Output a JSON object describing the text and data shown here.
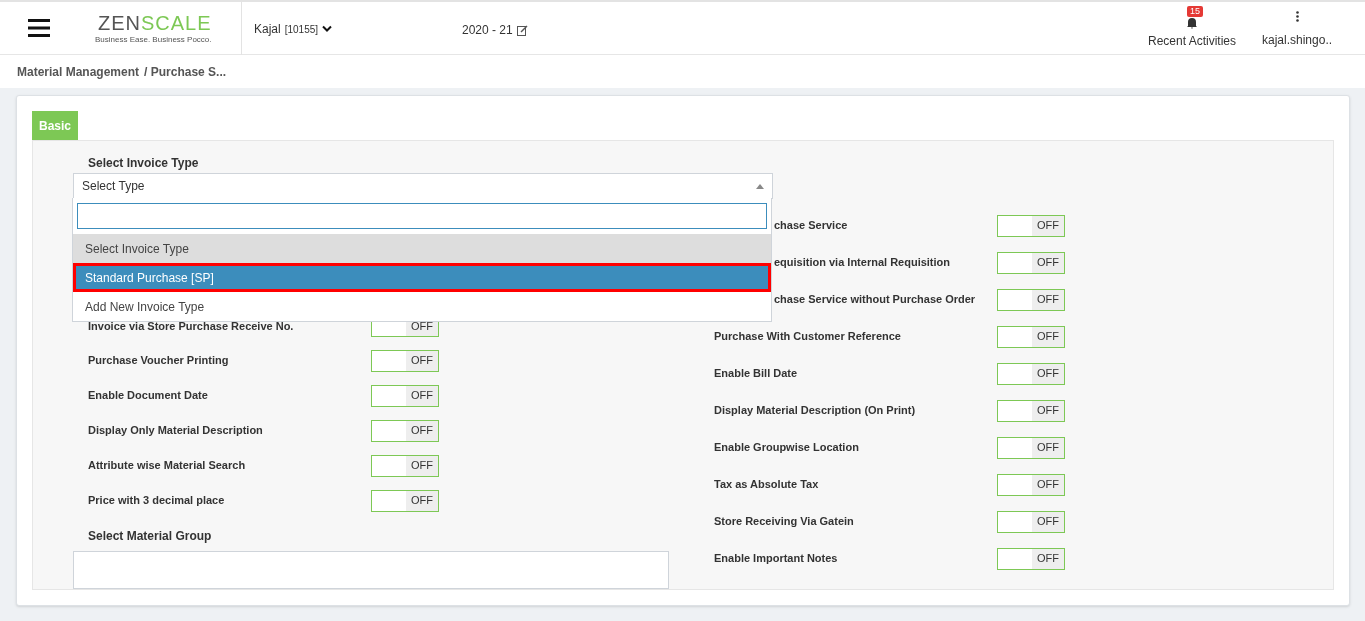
{
  "header": {
    "logo": {
      "dark": "ZEN",
      "light": "SCALE",
      "tagline": "Business Ease. Business Pocco."
    },
    "company": {
      "name": "Kajal",
      "code": "[10155]"
    },
    "year": "2020 - 21",
    "notifications": {
      "count": "15",
      "label": "Recent Activities"
    },
    "user": "kajal.shingo.."
  },
  "breadcrumb": [
    "Material Management",
    "/ Purchase S..."
  ],
  "tabs": [
    {
      "label": "Basic",
      "selected": true
    }
  ],
  "invoice_type": {
    "label": "Select Invoice Type",
    "value": "Select Type",
    "options": [
      {
        "label": "Select Invoice Type",
        "kind": "header",
        "selected": false
      },
      {
        "label": "Standard Purchase [SP]",
        "kind": "option",
        "selected": true
      },
      {
        "label": "Add New Invoice Type",
        "kind": "option",
        "selected": false
      }
    ]
  },
  "left_settings": [
    {
      "label": "Invoice via Store Purchase Receive No.",
      "state": "OFF",
      "on": false
    },
    {
      "label": "Purchase Voucher Printing",
      "state": "OFF",
      "on": false
    },
    {
      "label": "Enable Document Date",
      "state": "OFF",
      "on": false
    },
    {
      "label": "Display Only Material Description",
      "state": "OFF",
      "on": false
    },
    {
      "label": "Attribute wise Material Search",
      "state": "OFF",
      "on": false
    },
    {
      "label": "Price with 3 decimal place",
      "state": "OFF",
      "on": false
    }
  ],
  "material_group": {
    "label": "Select Material Group"
  },
  "right_settings": [
    {
      "label": "chase Service",
      "state": "OFF",
      "on": false,
      "partly_covered": true
    },
    {
      "label": "equisition via Internal Requisition",
      "state": "OFF",
      "on": false,
      "partly_covered": true
    },
    {
      "label": "chase Service without Purchase Order",
      "state": "OFF",
      "on": false,
      "partly_covered": true
    },
    {
      "label": "Purchase With Customer Reference",
      "state": "OFF",
      "on": false,
      "partly_covered": false
    },
    {
      "label": "Enable Bill Date",
      "state": "OFF",
      "on": false,
      "partly_covered": false
    },
    {
      "label": "Display Material Description (On Print)",
      "state": "OFF",
      "on": false,
      "partly_covered": false
    },
    {
      "label": "Enable Groupwise Location",
      "state": "OFF",
      "on": false,
      "partly_covered": false
    },
    {
      "label": "Tax as Absolute Tax",
      "state": "OFF",
      "on": false,
      "partly_covered": false
    },
    {
      "label": "Store Receiving Via Gatein",
      "state": "OFF",
      "on": false,
      "partly_covered": false
    },
    {
      "label": "Enable Important Notes",
      "state": "OFF",
      "on": false,
      "partly_covered": false
    }
  ]
}
